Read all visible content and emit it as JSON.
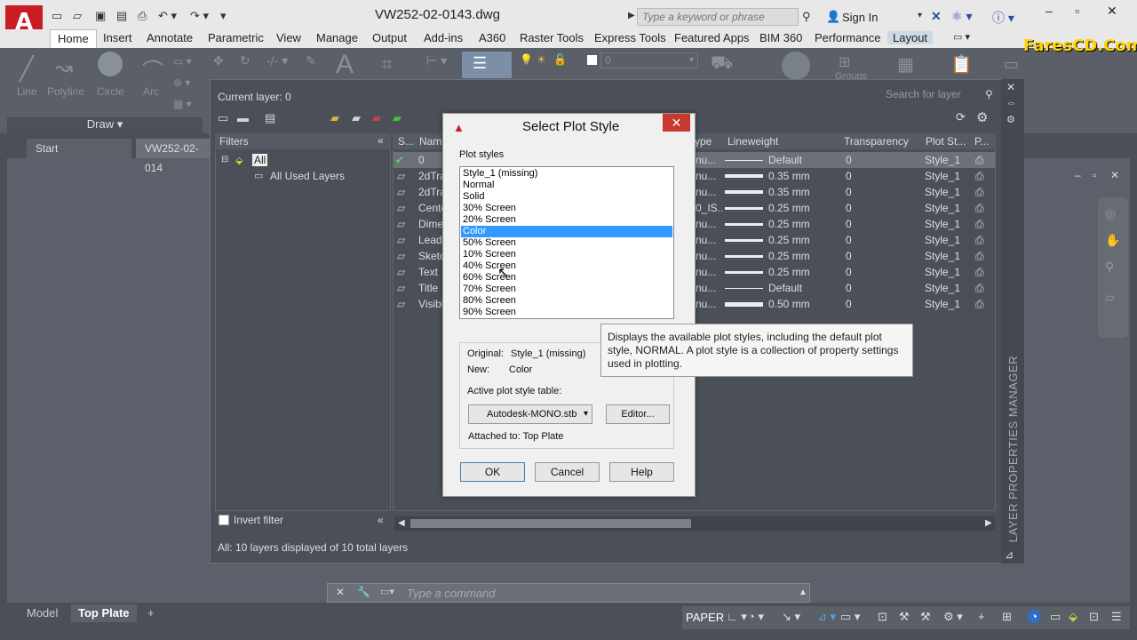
{
  "app": {
    "logo_letter": "A",
    "title": "VW252-02-0143.dwg",
    "search_placeholder": "Type a keyword or phrase",
    "sign_in": "Sign In",
    "watermark": "FaresCD.Com"
  },
  "ribbon": {
    "tabs": [
      "Home",
      "Insert",
      "Annotate",
      "Parametric",
      "View",
      "Manage",
      "Output",
      "Add-ins",
      "A360",
      "Raster Tools",
      "Express Tools",
      "Featured Apps",
      "BIM 360",
      "Performance",
      "Layout"
    ],
    "draw_tools": [
      "Line",
      "Polyline",
      "Circle",
      "Arc"
    ],
    "draw_panel": "Draw",
    "layer_value": "0",
    "groups_label": "Groups"
  },
  "doc_tabs": [
    "Start",
    "VW252-02-014"
  ],
  "lpm": {
    "current_layer": "Current layer: 0",
    "search_placeholder": "Search for layer",
    "filters_header": "Filters",
    "tree_all": "All",
    "tree_used": "All Used Layers",
    "invert_filter": "Invert filter",
    "status": "All: 10 layers displayed of 10 total layers",
    "vertical_label": "LAYER PROPERTIES MANAGER",
    "columns": [
      "S...",
      "Nam",
      "ype",
      "Lineweight",
      "Transparency",
      "Plot St...",
      "P..."
    ],
    "rows": [
      {
        "name": "0",
        "ltype": "nu...",
        "lw": "Default",
        "tr": "0",
        "ps": "Style_1"
      },
      {
        "name": "2dTra",
        "ltype": "nu...",
        "lw": "0.35 mm",
        "tr": "0",
        "ps": "Style_1"
      },
      {
        "name": "2dTra",
        "ltype": "nu...",
        "lw": "0.35 mm",
        "tr": "0",
        "ps": "Style_1"
      },
      {
        "name": "Cente",
        "ltype": "0_IS...",
        "lw": "0.25 mm",
        "tr": "0",
        "ps": "Style_1"
      },
      {
        "name": "Dime",
        "ltype": "nu...",
        "lw": "0.25 mm",
        "tr": "0",
        "ps": "Style_1"
      },
      {
        "name": "Leade",
        "ltype": "nu...",
        "lw": "0.25 mm",
        "tr": "0",
        "ps": "Style_1"
      },
      {
        "name": "Sketc",
        "ltype": "nu...",
        "lw": "0.25 mm",
        "tr": "0",
        "ps": "Style_1"
      },
      {
        "name": "Text",
        "ltype": "nu...",
        "lw": "0.25 mm",
        "tr": "0",
        "ps": "Style_1"
      },
      {
        "name": "Title",
        "ltype": "nu...",
        "lw": "Default",
        "tr": "0",
        "ps": "Style_1"
      },
      {
        "name": "Visibl",
        "ltype": "nu...",
        "lw": "0.50 mm",
        "tr": "0",
        "ps": "Style_1"
      }
    ]
  },
  "dialog": {
    "title": "Select Plot Style",
    "plot_styles_label": "Plot styles",
    "styles": [
      "Style_1 (missing)",
      "Normal",
      "Solid",
      "30% Screen",
      "20% Screen",
      "Color",
      "50% Screen",
      "10% Screen",
      "40% Screen",
      "60% Screen",
      "70% Screen",
      "80% Screen",
      "90% Screen"
    ],
    "selected": "Color",
    "original_label": "Original:",
    "original_value": "Style_1 (missing)",
    "new_label": "New:",
    "new_value": "Color",
    "active_table_label": "Active plot style table:",
    "active_table": "Autodesk-MONO.stb",
    "editor": "Editor...",
    "attached_to": "Attached to: Top Plate",
    "ok": "OK",
    "cancel": "Cancel",
    "help": "Help"
  },
  "tooltip": "Displays the available plot styles, including the default plot style, NORMAL. A plot style is a collection of property settings used in plotting.",
  "command": {
    "placeholder": "Type a command"
  },
  "layout_tabs": [
    "Model",
    "Top Plate"
  ],
  "status": {
    "paper": "PAPER"
  }
}
